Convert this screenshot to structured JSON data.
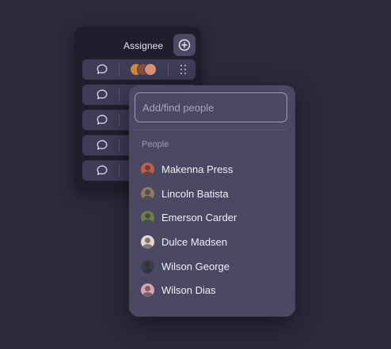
{
  "assignee_panel": {
    "title": "Assignee",
    "add_icon": "plus-circle-icon",
    "rows": [
      {
        "comment_icon": "comment-bubble-icon",
        "has_avatars": true
      },
      {
        "comment_icon": "comment-bubble-icon",
        "has_avatars": false
      },
      {
        "comment_icon": "comment-bubble-icon",
        "has_avatars": false
      },
      {
        "comment_icon": "comment-bubble-icon",
        "has_avatars": false
      },
      {
        "comment_icon": "comment-bubble-icon",
        "has_avatars": false
      }
    ],
    "drag_icon": "drag-handle-icon"
  },
  "people_dropdown": {
    "search_placeholder": "Add/find people",
    "section_label": "People",
    "people": [
      {
        "name": "Makenna Press",
        "avatar_color": "#b9614e"
      },
      {
        "name": "Lincoln Batista",
        "avatar_color": "#8a7a6a"
      },
      {
        "name": "Emerson Carder",
        "avatar_color": "#6d7a58"
      },
      {
        "name": "Dulce Madsen",
        "avatar_color": "#e3d7d2"
      },
      {
        "name": "Wilson George",
        "avatar_color": "#3b3f4c"
      },
      {
        "name": "Wilson Dias",
        "avatar_color": "#d4a4b4"
      }
    ]
  }
}
